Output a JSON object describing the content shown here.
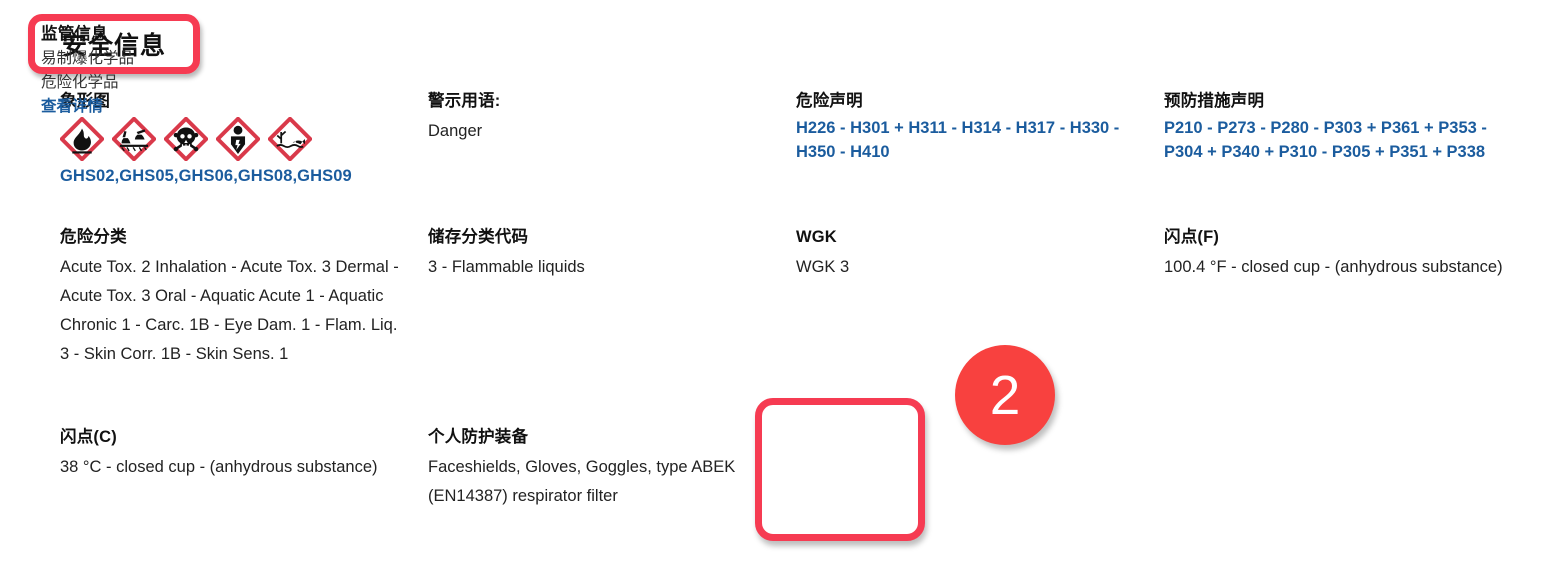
{
  "section": {
    "title": "安全信息",
    "highlight_color": "#f63b52"
  },
  "colors": {
    "link": "#1b5c9e",
    "annotation_red": "#f63b52",
    "badge_red": "#f8413f"
  },
  "fields": {
    "pictograms": {
      "label": "象形图",
      "codes": "GHS02,GHS05,GHS06,GHS08,GHS09",
      "items": [
        {
          "code": "GHS02",
          "icon": "flame-icon"
        },
        {
          "code": "GHS05",
          "icon": "corrosion-icon"
        },
        {
          "code": "GHS06",
          "icon": "skull-crossbones-icon"
        },
        {
          "code": "GHS08",
          "icon": "health-hazard-icon"
        },
        {
          "code": "GHS09",
          "icon": "environment-icon"
        }
      ]
    },
    "signal_word": {
      "label": "警示用语:",
      "value": "Danger"
    },
    "hazard_statements": {
      "label": "危险声明",
      "value": "H226 - H301 + H311 - H314 - H317 - H330 - H350 - H410"
    },
    "precautionary_statements": {
      "label": "预防措施声明",
      "value": "P210 - P273 - P280 - P303 + P361 + P353 - P304 + P340 + P310 - P305 + P351 + P338"
    },
    "hazard_classification": {
      "label": "危险分类",
      "value": "Acute Tox. 2 Inhalation - Acute Tox. 3 Dermal - Acute Tox. 3 Oral - Aquatic Acute 1 - Aquatic Chronic 1 - Carc. 1B - Eye Dam. 1 - Flam. Liq. 3 - Skin Corr. 1B - Skin Sens. 1"
    },
    "storage_class_code": {
      "label": "储存分类代码",
      "value": "3 - Flammable liquids"
    },
    "wgk": {
      "label": "WGK",
      "value": "WGK 3"
    },
    "flash_point_f": {
      "label": "闪点(F)",
      "value": "100.4 °F - closed cup - (anhydrous substance)"
    },
    "flash_point_c": {
      "label": "闪点(C)",
      "value": "38 °C - closed cup - (anhydrous substance)"
    },
    "personal_protective_equipment": {
      "label": "个人防护装备",
      "value": "Faceshields, Gloves, Goggles, type ABEK (EN14387) respirator filter"
    },
    "regulatory_info": {
      "label": "监管信息",
      "line1": "易制爆化学品",
      "line2": "危险化学品",
      "link": "查看详情"
    }
  },
  "annotations": {
    "step_badge": "2"
  }
}
